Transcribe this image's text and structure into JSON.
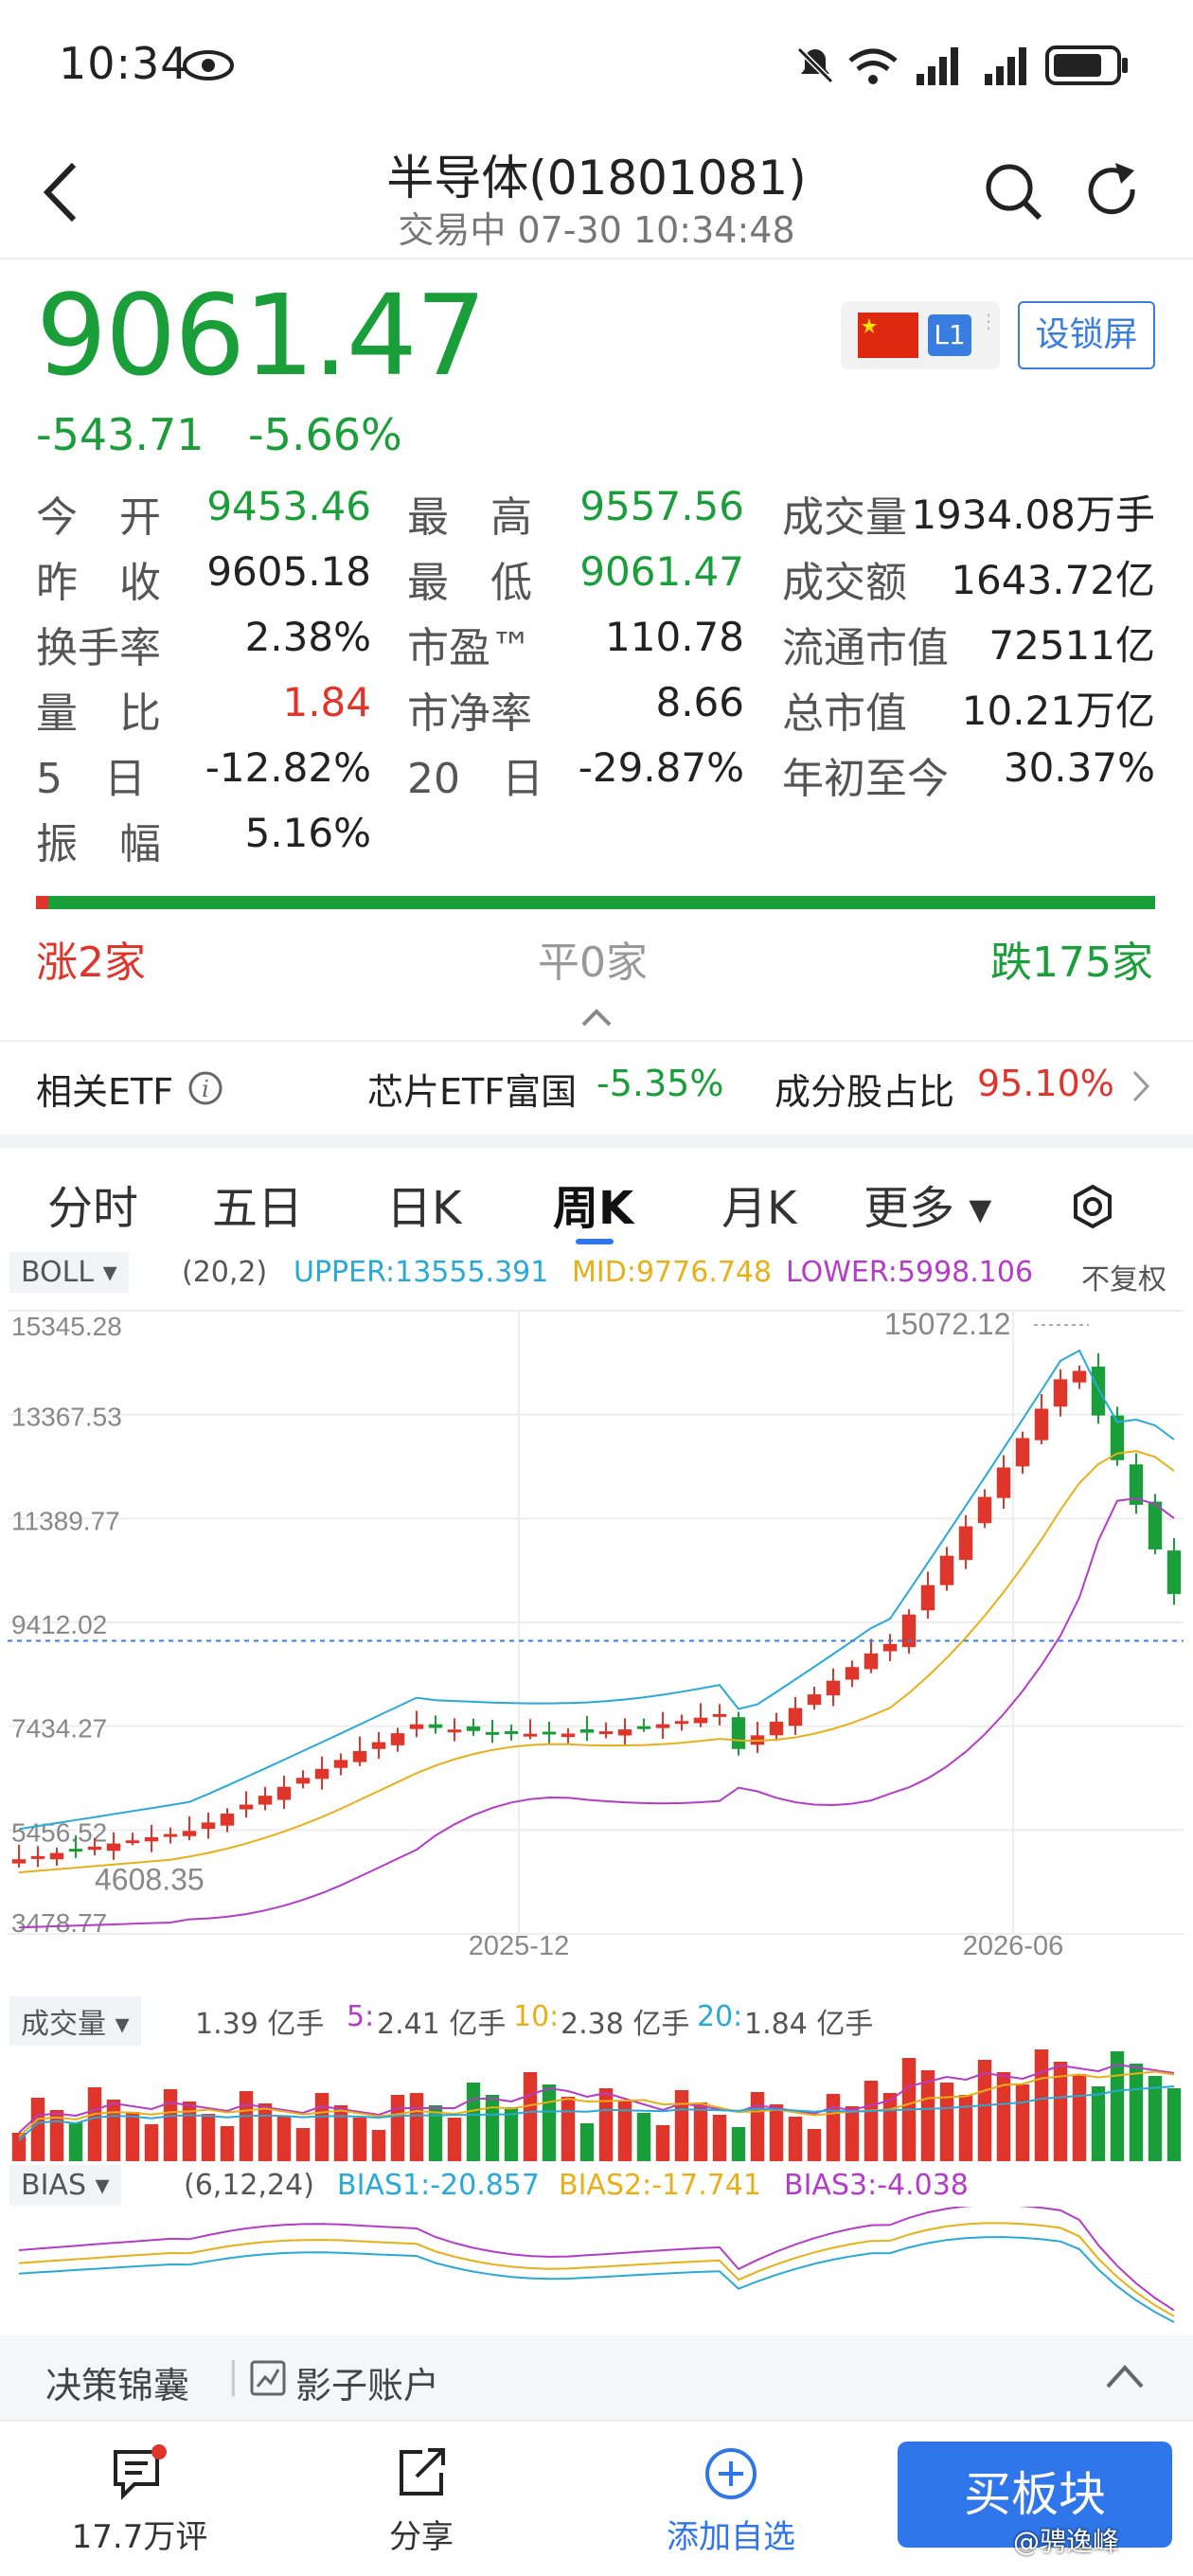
{
  "status_bar": {
    "time": "10:34"
  },
  "header": {
    "title": "半导体(01801081)",
    "subtitle": "交易中 07-30 10:34:48"
  },
  "quote": {
    "price": "9061.47",
    "change": "-543.71",
    "change_pct": "-5.66%",
    "badge": "L1",
    "lock_label": "设锁屏"
  },
  "stats": [
    [
      {
        "label": "今　开",
        "value": "9453.46",
        "color": "green"
      },
      {
        "label": "最　高",
        "value": "9557.56",
        "color": "green"
      },
      {
        "label": "成交量",
        "value": "1934.08万手",
        "color": "dark"
      }
    ],
    [
      {
        "label": "昨　收",
        "value": "9605.18",
        "color": "dark"
      },
      {
        "label": "最　低",
        "value": "9061.47",
        "color": "green"
      },
      {
        "label": "成交额",
        "value": "1643.72亿",
        "color": "dark"
      }
    ],
    [
      {
        "label": "换手率",
        "value": "2.38%",
        "color": "dark"
      },
      {
        "label": "市盈™",
        "value": "110.78",
        "color": "dark"
      },
      {
        "label": "流通市值",
        "value": "72511亿",
        "color": "dark"
      }
    ],
    [
      {
        "label": "量　比",
        "value": "1.84",
        "color": "red"
      },
      {
        "label": "市净率",
        "value": "8.66",
        "color": "dark"
      },
      {
        "label": "总市值",
        "value": "10.21万亿",
        "color": "dark"
      }
    ],
    [
      {
        "label": "5　日",
        "value": "-12.82%",
        "color": "dark"
      },
      {
        "label": "20　日",
        "value": "-29.87%",
        "color": "dark"
      },
      {
        "label": "年初至今",
        "value": "30.37%",
        "color": "dark"
      }
    ],
    [
      {
        "label": "振　幅",
        "value": "5.16%",
        "color": "dark"
      }
    ]
  ],
  "breadth": {
    "up": "涨2家",
    "flat": "平0家",
    "down": "跌175家",
    "up_fraction": 0.011
  },
  "etf": {
    "label": "相关ETF",
    "name": "芯片ETF富国",
    "pct": "-5.35%",
    "ratio_label": "成分股占比",
    "ratio": "95.10%"
  },
  "tabs": [
    "分时",
    "五日",
    "日K",
    "周K",
    "月K",
    "更多"
  ],
  "active_tab": "周K",
  "boll": {
    "label": "BOLL",
    "params": "(20,2)",
    "upper": "UPPER:13555.391",
    "mid": "MID:9776.748",
    "lower": "LOWER:5998.106",
    "adjust": "不复权"
  },
  "volume_header": {
    "label": "成交量",
    "value": "1.39 亿手",
    "ma5": "2.41 亿手",
    "ma10": "2.38 亿手",
    "ma20": "1.84 亿手"
  },
  "bias": {
    "label": "BIAS",
    "params": "(6,12,24)",
    "b1": "BIAS1:-20.857",
    "b2": "BIAS2:-17.741",
    "b3": "BIAS3:-4.038"
  },
  "chart_data": {
    "type": "candlestick",
    "y_ticks": [
      "15345.28",
      "13367.53",
      "11389.77",
      "9412.02",
      "7434.27",
      "5456.52",
      "3478.77"
    ],
    "ylim": [
      3478.77,
      15345.28
    ],
    "x_ticks": [
      "2025-12",
      "2026-06"
    ],
    "max_label": "15072.12",
    "min_label": "4608.35",
    "current_price": 9061.47,
    "series_colors": {
      "up": "#e0352b",
      "down": "#1a9e3a",
      "upper": "#29a9d8",
      "mid": "#e8b018",
      "lower": "#b43cc8"
    }
  },
  "bottom": {
    "decision": "决策锦囊",
    "shadow": "影子账户",
    "comments": "17.7万评",
    "share": "分享",
    "add": "添加自选",
    "buy": "买板块",
    "watermark": "@骋逸峰"
  }
}
